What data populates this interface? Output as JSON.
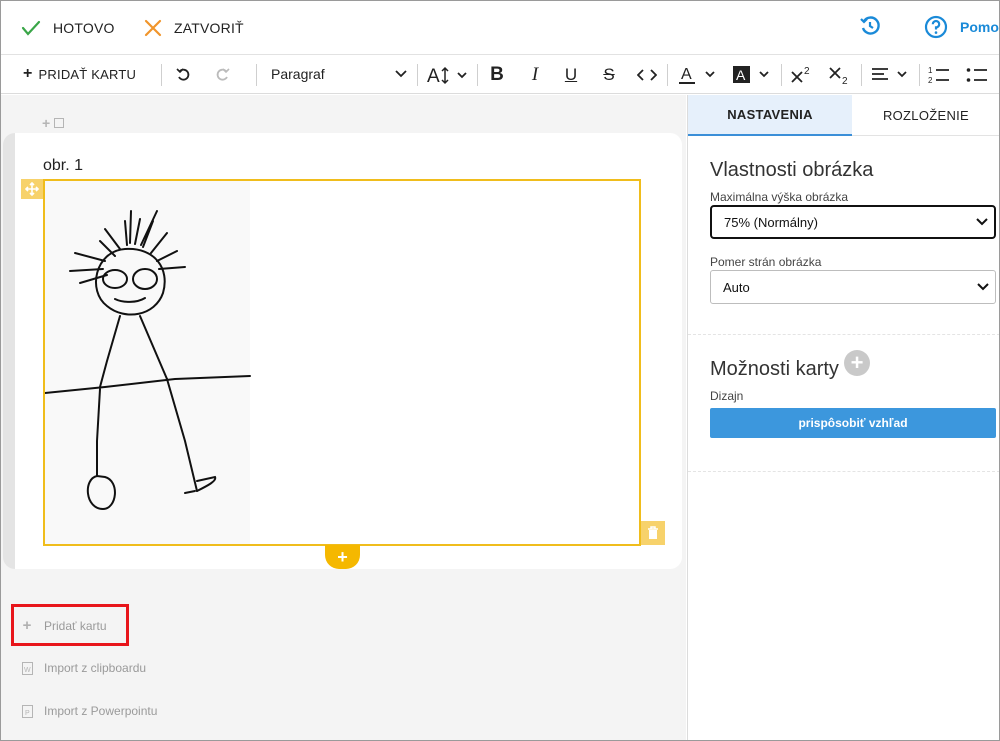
{
  "topbar": {
    "done_label": "HOTOVO",
    "close_label": "ZATVORIŤ",
    "help_label": "Pomo"
  },
  "toolbar": {
    "add_card_label": "PRIDAŤ KARTU",
    "paragraph_value": "Paragraf",
    "icons": [
      "undo-icon",
      "redo-icon",
      "font-size-icon",
      "bold-icon",
      "italic-icon",
      "underline-icon",
      "strikethrough-icon",
      "code-icon",
      "font-color-icon",
      "highlight-color-icon",
      "superscript-icon",
      "subscript-icon",
      "align-icon",
      "ordered-list-icon",
      "bullet-list-icon"
    ]
  },
  "editor": {
    "card_title": "obr. 1",
    "image": "child-stick-figure-drawing",
    "links": {
      "add_card": "Pridať kartu",
      "import_clipboard": "Import z clipboardu",
      "import_powerpoint": "Import z Powerpointu"
    }
  },
  "panel": {
    "tabs": [
      "NASTAVENIA",
      "ROZLOŽENIE"
    ],
    "image_props_title": "Vlastnosti obrázka",
    "max_height_label": "Maximálna výška obrázka",
    "max_height_value": "75% (Normálny)",
    "aspect_label": "Pomer strán obrázka",
    "aspect_value": "Auto",
    "card_options_title": "Možnosti karty",
    "design_label": "Dizajn",
    "customize_button": "prispôsobiť vzhľad"
  },
  "colors": {
    "accent": "#3c97dd",
    "selection": "#f0bd1c",
    "highlight_box": "#e8151b",
    "done_check": "#3aa648",
    "close_x": "#f0952b"
  }
}
